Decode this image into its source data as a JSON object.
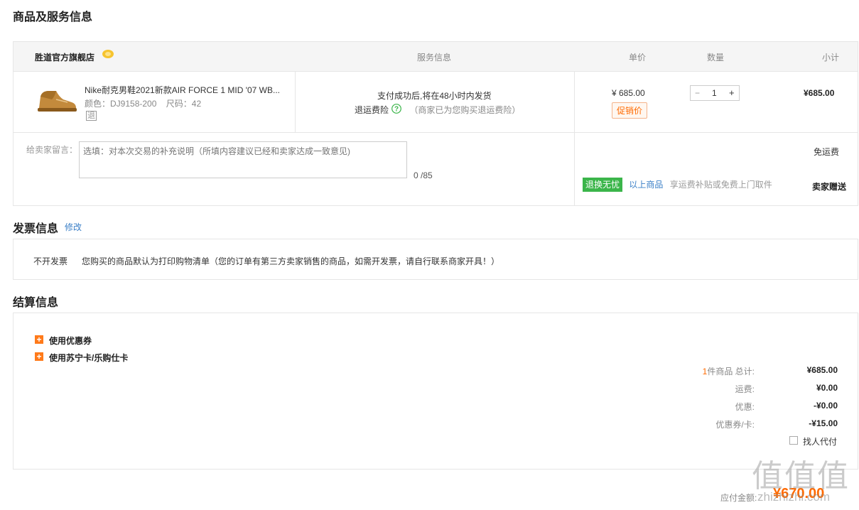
{
  "product_section": {
    "title": "商品及服务信息",
    "header": {
      "shop_name": "胜道官方旗舰店",
      "col_service": "服务信息",
      "col_price": "单价",
      "col_qty": "数量",
      "col_subtotal": "小计"
    },
    "item": {
      "name": "Nike耐克男鞋2021新款AIR FORCE 1 MID '07 WB...",
      "color_label": "颜色：",
      "color_value": "DJ9158-200",
      "size_label": "尺码：",
      "size_value": "42",
      "return_mark": "退",
      "service_ship": "支付成功后,将在48小时内发货",
      "service_insurance": "退运费险",
      "service_insurance_note": "（商家已为您购买退运费险）",
      "unit_price": "¥ 685.00",
      "promo_tag": "促销价",
      "qty_minus": "−",
      "qty_value": "1",
      "qty_plus": "+",
      "subtotal": "¥685.00"
    },
    "message": {
      "label": "给卖家留言：",
      "placeholder": "选填：对本次交易的补充说明（所填内容建议已经和卖家达成一致意见)",
      "counter": "0 /85"
    },
    "shipping": {
      "free_shipping": "免运费",
      "return_tag": "退换无忧",
      "return_link": "以上商品",
      "return_desc": "享运费补贴或免费上门取件",
      "seller_gift": "卖家赠送"
    }
  },
  "invoice_section": {
    "title": "发票信息",
    "edit_link": "修改",
    "type": "不开发票",
    "note": "您购买的商品默认为打印购物清单（您的订单有第三方卖家销售的商品，如需开发票，请自行联系商家开具！）"
  },
  "settlement_section": {
    "title": "结算信息",
    "options": [
      {
        "label": "使用优惠券"
      },
      {
        "label": "使用苏宁卡/乐购仕卡"
      }
    ],
    "summary": {
      "count_number": "1",
      "count_label": "件商品 总计:",
      "total": "¥685.00",
      "shipping_label": "运费:",
      "shipping": "¥0.00",
      "discount_label": "优惠:",
      "discount": "-¥0.00",
      "coupon_label": "优惠券/卡:",
      "coupon": "-¥15.00",
      "proxy_pay": "找人代付"
    },
    "payable_label": "应付金额:",
    "payable": "¥670.00"
  },
  "watermark": "值 值 值",
  "watermark_sub": "zhizhizhi.com",
  "colors": {
    "accent_orange": "#ff6a00",
    "link_blue": "#3a7fc7",
    "green_tag": "#3bb54a",
    "header_bg": "#f5f5f5"
  }
}
